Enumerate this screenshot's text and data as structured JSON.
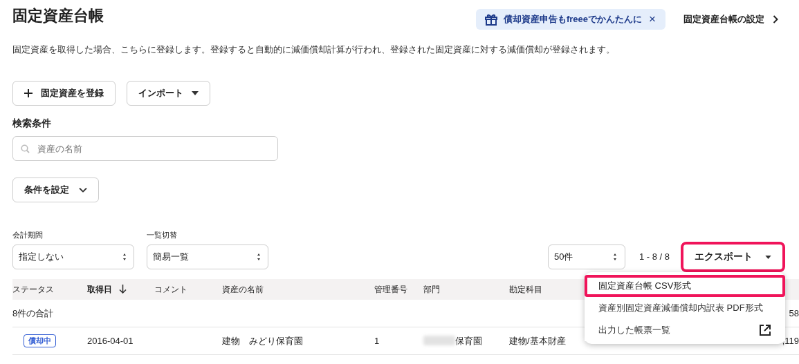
{
  "title": "固定資産台帳",
  "promo": {
    "text": "償却資産申告もfreeeでかんたんに",
    "close": "×"
  },
  "settings_link": "固定資産台帳の設定",
  "description": "固定資産を取得した場合、こちらに登録します。登録すると自動的に減価償却計算が行われ、登録された固定資産に対する減価償却が登録されます。",
  "actions": [
    {
      "kind": "plus",
      "label": "固定資産を登録"
    },
    {
      "kind": "dropdown",
      "label": "インポート"
    }
  ],
  "search": {
    "heading": "検索条件",
    "placeholder": "資産の名前"
  },
  "filter_button": "条件を設定",
  "selects": [
    {
      "label": "会計期間",
      "value": "指定しない"
    },
    {
      "label": "一覧切替",
      "value": "簡易一覧"
    }
  ],
  "page_size": "50件",
  "range": "1 - 8 / 8",
  "export": {
    "label": "エクスポート",
    "expanded": true,
    "menu": [
      {
        "label": "固定資産台帳 CSV形式",
        "selected": true,
        "external": false
      },
      {
        "label": "資産別固定資産減価償却内訳表 PDF形式",
        "selected": false,
        "external": false
      },
      {
        "label": "出力した帳票一覧",
        "selected": false,
        "external": true
      }
    ]
  },
  "table": {
    "columns": [
      {
        "label": "ステータス",
        "sorted": false
      },
      {
        "label": "取得日",
        "sorted": true
      },
      {
        "label": "コメント",
        "sorted": false
      },
      {
        "label": "資産の名前",
        "sorted": false
      },
      {
        "label": "管理番号",
        "sorted": false
      },
      {
        "label": "部門",
        "sorted": false
      },
      {
        "label": "勘定科目",
        "sorted": false
      }
    ],
    "total_row": {
      "label": "8件の合計",
      "column_last": "58"
    },
    "rows": [
      {
        "status": "償却中",
        "date": "2016-04-01",
        "comment": "",
        "name": "建物　みどり保育園",
        "number": "1",
        "department": "保育園",
        "department_blurred": true,
        "account": "建物/基本財産",
        "column_last": ",119"
      }
    ]
  }
}
